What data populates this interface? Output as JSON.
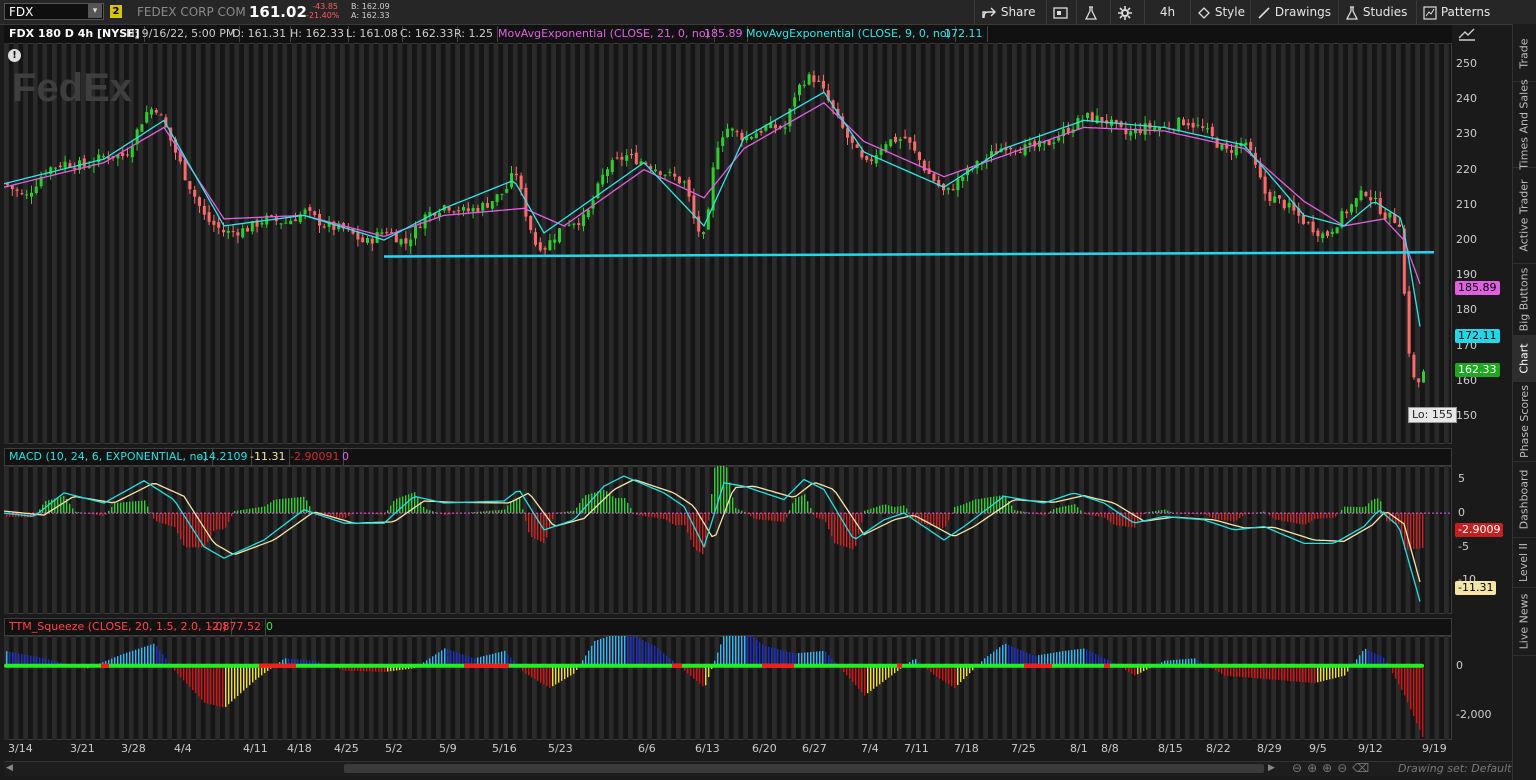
{
  "toolbar": {
    "symbol": "FDX",
    "link_number": "2",
    "company": "FEDEX CORP COM",
    "last_price": "161.02",
    "net_change": "-43.85",
    "pct_change": "-21.40%",
    "bid": "B: 162.09",
    "ask": "A: 162.33",
    "share": "Share",
    "timeframe": "4h",
    "style": "Style",
    "drawings": "Drawings",
    "studies": "Studies",
    "patterns": "Patterns"
  },
  "header": {
    "title": "FDX 180 D 4h [NYSE]",
    "date": "D: 9/16/22, 5:00 PM",
    "open": "O: 161.31",
    "high": "H: 162.33",
    "low": "L: 161.08",
    "close": "C: 162.33",
    "range": "R: 1.25",
    "ema21_label": "MovAvgExponential (CLOSE, 21, 0, no)",
    "ema21_value": "185.89",
    "ema9_label": "MovAvgExponential (CLOSE, 9, 0, no)",
    "ema9_value": "172.11"
  },
  "macd_header": {
    "label": "MACD (10, 24, 6, EXPONENTIAL, no)",
    "value": "-14.2109",
    "avg": "-11.31",
    "diff": "-2.90091",
    "zero": "0"
  },
  "ttm_header": {
    "label": "TTM_Squeeze (CLOSE, 20, 1.5, 2.0, 1.0)",
    "value": "-2,877.52",
    "zero": "0"
  },
  "price_axis": {
    "ticks": [
      "250",
      "240",
      "230",
      "220",
      "210",
      "200",
      "190",
      "180",
      "170",
      "160",
      "150"
    ],
    "ema21_tag": "185.89",
    "ema9_tag": "172.11",
    "last_tag": "162.33",
    "low_callout": "Lo: 155"
  },
  "macd_axis": {
    "ticks": [
      "5",
      "0",
      "-5",
      "-10"
    ],
    "diff_tag": "-2.9009",
    "avg_tag": "-11.31"
  },
  "ttm_axis": {
    "ticks": [
      "0",
      "-2,000"
    ]
  },
  "x_axis": {
    "labels": [
      "3/14",
      "3/21",
      "3/28",
      "4/4",
      "4/11",
      "4/18",
      "4/25",
      "5/2",
      "5/9",
      "5/16",
      "5/23",
      "6/6",
      "6/13",
      "6/20",
      "6/27",
      "7/4",
      "7/11",
      "7/18",
      "7/25",
      "8/1",
      "8/8",
      "8/15",
      "8/22",
      "8/29",
      "9/5",
      "9/12",
      "9/19"
    ]
  },
  "footer": {
    "drawing_set": "Drawing set: Default"
  },
  "sidebar": {
    "tabs": [
      "Trade",
      "Times And Sales",
      "Active Trader",
      "Big Buttons",
      "Chart",
      "Phase Scores",
      "Dashboard",
      "Level II",
      "Live News"
    ],
    "active": "Chart"
  },
  "watermark": "FedEx",
  "colors": {
    "up": "#2ecc2e",
    "down": "#ff6a6a",
    "ema9": "#2ee6e6",
    "ema21": "#e060e0",
    "support_line": "#22d8f0",
    "macd": "#22e0e0",
    "macd_avg": "#f5e6a8",
    "squeeze_on": "#ff1a1a",
    "squeeze_off": "#22ee22"
  },
  "chart_data": {
    "type": "candlestick",
    "price_ylim": [
      142,
      256
    ],
    "support_level": 196.5,
    "close_path": [
      [
        0,
        216
      ],
      [
        20,
        212
      ],
      [
        40,
        220
      ],
      [
        60,
        222
      ],
      [
        80,
        221
      ],
      [
        100,
        224
      ],
      [
        120,
        224
      ],
      [
        140,
        236
      ],
      [
        150,
        238
      ],
      [
        160,
        232
      ],
      [
        180,
        218
      ],
      [
        200,
        206
      ],
      [
        220,
        202
      ],
      [
        240,
        203
      ],
      [
        260,
        206
      ],
      [
        280,
        205
      ],
      [
        300,
        208
      ],
      [
        320,
        204
      ],
      [
        340,
        203
      ],
      [
        360,
        199
      ],
      [
        380,
        203
      ],
      [
        400,
        199
      ],
      [
        420,
        207
      ],
      [
        440,
        210
      ],
      [
        460,
        208
      ],
      [
        480,
        210
      ],
      [
        500,
        214
      ],
      [
        510,
        220
      ],
      [
        520,
        208
      ],
      [
        530,
        199
      ],
      [
        540,
        198
      ],
      [
        560,
        205
      ],
      [
        580,
        206
      ],
      [
        600,
        220
      ],
      [
        620,
        224
      ],
      [
        640,
        222
      ],
      [
        660,
        219
      ],
      [
        680,
        216
      ],
      [
        690,
        204
      ],
      [
        700,
        200
      ],
      [
        710,
        226
      ],
      [
        720,
        232
      ],
      [
        740,
        229
      ],
      [
        760,
        232
      ],
      [
        780,
        232
      ],
      [
        790,
        242
      ],
      [
        800,
        246
      ],
      [
        810,
        246
      ],
      [
        820,
        241
      ],
      [
        840,
        230
      ],
      [
        860,
        221
      ],
      [
        880,
        228
      ],
      [
        900,
        229
      ],
      [
        920,
        220
      ],
      [
        940,
        213
      ],
      [
        960,
        219
      ],
      [
        980,
        223
      ],
      [
        1000,
        227
      ],
      [
        1020,
        226
      ],
      [
        1040,
        227
      ],
      [
        1060,
        231
      ],
      [
        1080,
        235
      ],
      [
        1100,
        234
      ],
      [
        1120,
        230
      ],
      [
        1140,
        232
      ],
      [
        1160,
        232
      ],
      [
        1180,
        234
      ],
      [
        1200,
        231
      ],
      [
        1220,
        225
      ],
      [
        1240,
        228
      ],
      [
        1260,
        213
      ],
      [
        1280,
        210
      ],
      [
        1300,
        205
      ],
      [
        1320,
        201
      ],
      [
        1340,
        208
      ],
      [
        1360,
        214
      ],
      [
        1380,
        207
      ],
      [
        1395,
        205
      ],
      [
        1400,
        178
      ],
      [
        1405,
        165
      ],
      [
        1410,
        158
      ],
      [
        1418,
        162
      ]
    ],
    "ema21_path": [
      [
        0,
        215
      ],
      [
        100,
        222
      ],
      [
        160,
        232
      ],
      [
        220,
        206
      ],
      [
        300,
        207
      ],
      [
        380,
        201
      ],
      [
        440,
        207
      ],
      [
        520,
        209
      ],
      [
        560,
        204
      ],
      [
        640,
        220
      ],
      [
        700,
        212
      ],
      [
        740,
        226
      ],
      [
        820,
        239
      ],
      [
        860,
        228
      ],
      [
        940,
        218
      ],
      [
        1000,
        224
      ],
      [
        1080,
        232
      ],
      [
        1160,
        231
      ],
      [
        1240,
        226
      ],
      [
        1300,
        211
      ],
      [
        1340,
        204
      ],
      [
        1380,
        206
      ],
      [
        1400,
        200
      ],
      [
        1418,
        186
      ]
    ],
    "ema9_path": [
      [
        0,
        216
      ],
      [
        100,
        223
      ],
      [
        160,
        234
      ],
      [
        220,
        204
      ],
      [
        300,
        207
      ],
      [
        380,
        200
      ],
      [
        440,
        209
      ],
      [
        510,
        217
      ],
      [
        540,
        202
      ],
      [
        640,
        222
      ],
      [
        700,
        204
      ],
      [
        740,
        229
      ],
      [
        820,
        242
      ],
      [
        860,
        225
      ],
      [
        940,
        215
      ],
      [
        1000,
        226
      ],
      [
        1080,
        234
      ],
      [
        1160,
        232
      ],
      [
        1240,
        227
      ],
      [
        1300,
        207
      ],
      [
        1340,
        204
      ],
      [
        1370,
        211
      ],
      [
        1398,
        206
      ],
      [
        1418,
        172
      ]
    ],
    "macd_ylim": [
      -15,
      7
    ],
    "macd_path": [
      [
        0,
        0
      ],
      [
        30,
        -0.5
      ],
      [
        60,
        3
      ],
      [
        100,
        1.5
      ],
      [
        140,
        4.8
      ],
      [
        170,
        2
      ],
      [
        200,
        -5
      ],
      [
        220,
        -6.7
      ],
      [
        260,
        -4
      ],
      [
        300,
        0.5
      ],
      [
        340,
        -1.5
      ],
      [
        380,
        -1.5
      ],
      [
        410,
        2.5
      ],
      [
        440,
        1.5
      ],
      [
        500,
        1.8
      ],
      [
        515,
        3.5
      ],
      [
        540,
        -2.5
      ],
      [
        570,
        -1
      ],
      [
        600,
        4
      ],
      [
        620,
        5.5
      ],
      [
        660,
        3
      ],
      [
        680,
        1
      ],
      [
        700,
        -5
      ],
      [
        720,
        4.5
      ],
      [
        740,
        4
      ],
      [
        780,
        2
      ],
      [
        800,
        5
      ],
      [
        820,
        3.5
      ],
      [
        850,
        -4
      ],
      [
        880,
        -1
      ],
      [
        900,
        0
      ],
      [
        940,
        -4
      ],
      [
        960,
        -2
      ],
      [
        1000,
        2.5
      ],
      [
        1040,
        1.5
      ],
      [
        1070,
        3
      ],
      [
        1100,
        1.5
      ],
      [
        1130,
        -1.5
      ],
      [
        1160,
        -0.5
      ],
      [
        1200,
        -1
      ],
      [
        1230,
        -2.5
      ],
      [
        1260,
        -2
      ],
      [
        1300,
        -4.5
      ],
      [
        1330,
        -4.5
      ],
      [
        1360,
        -2
      ],
      [
        1375,
        0.5
      ],
      [
        1395,
        -2
      ],
      [
        1418,
        -14.2
      ]
    ],
    "macd_avg_path": [
      [
        0,
        0.3
      ],
      [
        40,
        -0.3
      ],
      [
        70,
        2.5
      ],
      [
        110,
        1.5
      ],
      [
        150,
        4.5
      ],
      [
        180,
        2.5
      ],
      [
        210,
        -4.5
      ],
      [
        230,
        -6.2
      ],
      [
        270,
        -4
      ],
      [
        310,
        0.2
      ],
      [
        350,
        -1.5
      ],
      [
        390,
        -1.3
      ],
      [
        420,
        1.8
      ],
      [
        450,
        1.6
      ],
      [
        505,
        1.5
      ],
      [
        525,
        3
      ],
      [
        550,
        -2
      ],
      [
        580,
        -0.8
      ],
      [
        610,
        3.5
      ],
      [
        630,
        5
      ],
      [
        670,
        3
      ],
      [
        690,
        1
      ],
      [
        710,
        -4
      ],
      [
        730,
        3.8
      ],
      [
        750,
        4
      ],
      [
        790,
        2.3
      ],
      [
        810,
        4.6
      ],
      [
        830,
        3.5
      ],
      [
        860,
        -3.2
      ],
      [
        890,
        -1
      ],
      [
        910,
        -0.3
      ],
      [
        950,
        -3.5
      ],
      [
        970,
        -2
      ],
      [
        1010,
        2
      ],
      [
        1050,
        1.6
      ],
      [
        1080,
        2.6
      ],
      [
        1110,
        1.5
      ],
      [
        1140,
        -1.2
      ],
      [
        1170,
        -0.6
      ],
      [
        1210,
        -1
      ],
      [
        1240,
        -2.2
      ],
      [
        1270,
        -2.1
      ],
      [
        1310,
        -4
      ],
      [
        1340,
        -4.2
      ],
      [
        1368,
        -1.8
      ],
      [
        1382,
        0.3
      ],
      [
        1400,
        -1.6
      ],
      [
        1418,
        -11.31
      ]
    ],
    "ttm_ylim": [
      -3000,
      1200
    ],
    "ttm_bars": [
      [
        0,
        600
      ],
      [
        40,
        300
      ],
      [
        80,
        -150
      ],
      [
        120,
        500
      ],
      [
        150,
        900
      ],
      [
        170,
        -200
      ],
      [
        200,
        -1500
      ],
      [
        220,
        -1700
      ],
      [
        250,
        -600
      ],
      [
        280,
        300
      ],
      [
        310,
        200
      ],
      [
        340,
        -200
      ],
      [
        380,
        -250
      ],
      [
        410,
        -100
      ],
      [
        440,
        700
      ],
      [
        470,
        300
      ],
      [
        500,
        600
      ],
      [
        520,
        -300
      ],
      [
        545,
        -900
      ],
      [
        570,
        -300
      ],
      [
        590,
        1000
      ],
      [
        620,
        1400
      ],
      [
        650,
        800
      ],
      [
        680,
        -200
      ],
      [
        700,
        -900
      ],
      [
        720,
        1300
      ],
      [
        740,
        1400
      ],
      [
        760,
        800
      ],
      [
        790,
        500
      ],
      [
        820,
        600
      ],
      [
        840,
        -300
      ],
      [
        860,
        -1200
      ],
      [
        880,
        -600
      ],
      [
        910,
        300
      ],
      [
        930,
        -400
      ],
      [
        950,
        -900
      ],
      [
        980,
        300
      ],
      [
        1000,
        900
      ],
      [
        1030,
        400
      ],
      [
        1060,
        600
      ],
      [
        1080,
        700
      ],
      [
        1110,
        100
      ],
      [
        1130,
        -400
      ],
      [
        1160,
        200
      ],
      [
        1190,
        300
      ],
      [
        1220,
        -400
      ],
      [
        1250,
        -500
      ],
      [
        1280,
        -600
      ],
      [
        1310,
        -700
      ],
      [
        1340,
        -400
      ],
      [
        1360,
        700
      ],
      [
        1380,
        300
      ],
      [
        1400,
        -1200
      ],
      [
        1418,
        -2877
      ]
    ],
    "squeeze_on_ranges": [
      [
        97,
        105
      ],
      [
        255,
        292
      ],
      [
        460,
        505
      ],
      [
        668,
        678
      ],
      [
        758,
        790
      ],
      [
        893,
        898
      ],
      [
        1020,
        1048
      ],
      [
        1100,
        1106
      ]
    ]
  }
}
